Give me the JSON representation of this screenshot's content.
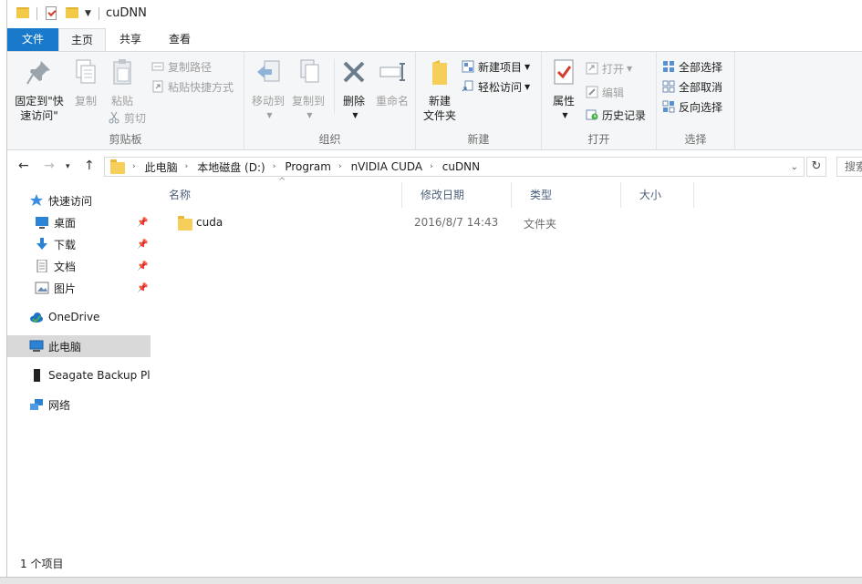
{
  "window": {
    "title": "cuDNN"
  },
  "tabs": {
    "file": "文件",
    "home": "主页",
    "share": "共享",
    "view": "查看"
  },
  "ribbon": {
    "clipboard": {
      "label": "剪贴板",
      "pin": "固定到\"快\n速访问\"",
      "pin_line1": "固定到\"快",
      "pin_line2": "速访问\"",
      "copy": "复制",
      "paste": "粘贴",
      "copy_path": "复制路径",
      "paste_shortcut": "粘贴快捷方式",
      "cut": "剪切"
    },
    "organize": {
      "label": "组织",
      "move_to": "移动到",
      "copy_to": "复制到",
      "delete": "删除",
      "rename": "重命名"
    },
    "new": {
      "label": "新建",
      "new_folder_line1": "新建",
      "new_folder_line2": "文件夹",
      "new_item": "新建项目",
      "easy_access": "轻松访问"
    },
    "open": {
      "label": "打开",
      "properties": "属性",
      "open": "打开",
      "edit": "编辑",
      "history": "历史记录"
    },
    "select": {
      "label": "选择",
      "select_all": "全部选择",
      "select_none": "全部取消",
      "invert": "反向选择"
    }
  },
  "address": {
    "crumbs": [
      "此电脑",
      "本地磁盘 (D:)",
      "Program",
      "nVIDIA CUDA",
      "cuDNN"
    ],
    "search_placeholder": "搜索"
  },
  "nav": {
    "quick_access": "快速访问",
    "desktop": "桌面",
    "downloads": "下载",
    "documents": "文档",
    "pictures": "图片",
    "onedrive": "OneDrive",
    "this_pc": "此电脑",
    "seagate": "Seagate Backup Plu",
    "network": "网络"
  },
  "columns": {
    "name": "名称",
    "modified": "修改日期",
    "type": "类型",
    "size": "大小"
  },
  "files": [
    {
      "name": "cuda",
      "modified": "2016/8/7 14:43",
      "type": "文件夹",
      "size": ""
    }
  ],
  "status": {
    "count": "1 个项目"
  },
  "colors": {
    "accent": "#1979ca",
    "folder": "#f5cf5a",
    "selected": "#d9d9d9"
  }
}
